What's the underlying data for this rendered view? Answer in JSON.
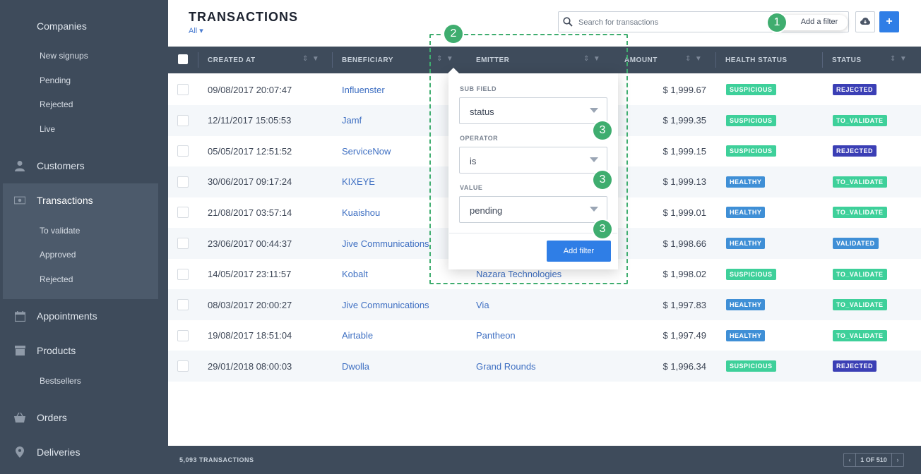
{
  "header": {
    "title": "TRANSACTIONS",
    "filter_label": "All ▾"
  },
  "search": {
    "placeholder": "Search for transactions",
    "add_filter": "Add a filter"
  },
  "sidebar": {
    "items": [
      {
        "label": "Companies",
        "icon": ""
      },
      {
        "label": "New signups"
      },
      {
        "label": "Pending"
      },
      {
        "label": "Rejected"
      },
      {
        "label": "Live"
      },
      {
        "label": "Customers",
        "icon": "person-icon"
      },
      {
        "label": "Transactions",
        "icon": "transactions-icon"
      },
      {
        "label": "To validate"
      },
      {
        "label": "Approved"
      },
      {
        "label": "Rejected"
      },
      {
        "label": "Appointments",
        "icon": "calendar-icon"
      },
      {
        "label": "Products",
        "icon": "box-icon"
      },
      {
        "label": "Bestsellers"
      },
      {
        "label": "Orders",
        "icon": "basket-icon"
      },
      {
        "label": "Deliveries",
        "icon": "location-pin-icon"
      }
    ]
  },
  "table": {
    "columns": [
      "CREATED AT",
      "BENEFICIARY",
      "EMITTER",
      "AMOUNT",
      "HEALTH STATUS",
      "STATUS"
    ],
    "rows": [
      {
        "created": "09/08/2017 20:07:47",
        "beneficiary": "Influenster",
        "emitter": "",
        "amount": "$ 1,999.67",
        "health": "SUSPICIOUS",
        "status": "REJECTED"
      },
      {
        "created": "12/11/2017 15:05:53",
        "beneficiary": "Jamf",
        "emitter": "",
        "amount": "$ 1,999.35",
        "health": "SUSPICIOUS",
        "status": "TO_VALIDATE"
      },
      {
        "created": "05/05/2017 12:51:52",
        "beneficiary": "ServiceNow",
        "emitter": "",
        "amount": "$ 1,999.15",
        "health": "SUSPICIOUS",
        "status": "REJECTED"
      },
      {
        "created": "30/06/2017 09:17:24",
        "beneficiary": "KIXEYE",
        "emitter": "",
        "amount": "$ 1,999.13",
        "health": "HEALTHY",
        "status": "TO_VALIDATE"
      },
      {
        "created": "21/08/2017 03:57:14",
        "beneficiary": "Kuaishou",
        "emitter": "",
        "amount": "$ 1,999.01",
        "health": "HEALTHY",
        "status": "TO_VALIDATE"
      },
      {
        "created": "23/06/2017 00:44:37",
        "beneficiary": "Jive Communications",
        "emitter": "",
        "amount": "$ 1,998.66",
        "health": "HEALTHY",
        "status": "VALIDATED"
      },
      {
        "created": "14/05/2017 23:11:57",
        "beneficiary": "Kobalt",
        "emitter": "Nazara Technologies",
        "amount": "$ 1,998.02",
        "health": "SUSPICIOUS",
        "status": "TO_VALIDATE"
      },
      {
        "created": "08/03/2017 20:00:27",
        "beneficiary": "Jive Communications",
        "emitter": "Via",
        "amount": "$ 1,997.83",
        "health": "HEALTHY",
        "status": "TO_VALIDATE"
      },
      {
        "created": "19/08/2017 18:51:04",
        "beneficiary": "Airtable",
        "emitter": "Pantheon",
        "amount": "$ 1,997.49",
        "health": "HEALTHY",
        "status": "TO_VALIDATE"
      },
      {
        "created": "29/01/2018 08:00:03",
        "beneficiary": "Dwolla",
        "emitter": "Grand Rounds",
        "amount": "$ 1,996.34",
        "health": "SUSPICIOUS",
        "status": "REJECTED"
      }
    ]
  },
  "filter_popup": {
    "sub_field_label": "SUB FIELD",
    "sub_field_value": "status",
    "operator_label": "OPERATOR",
    "operator_value": "is",
    "value_label": "VALUE",
    "value_value": "pending",
    "button": "Add filter"
  },
  "footer": {
    "count": "5,093 TRANSACTIONS",
    "page": "1 OF 510"
  },
  "annotations": {
    "m1": "1",
    "m2": "2",
    "m3a": "3",
    "m3b": "3",
    "m3c": "3"
  },
  "colors": {
    "sidebar": "#3e4b5b",
    "accent": "#2f7ee6",
    "suspicious": "#3ed09a",
    "healthy": "#3f8fd6",
    "rejected": "#3b3fb5",
    "to_validate": "#3ed09a",
    "validated": "#3f8fd6",
    "annotation": "#3fad6f"
  }
}
